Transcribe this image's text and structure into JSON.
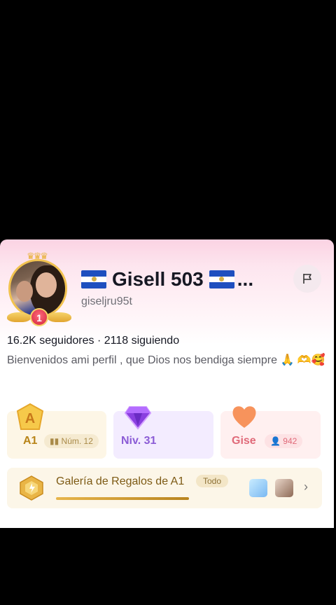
{
  "profile": {
    "display_name": "Gisell 503",
    "ellipsis": "...",
    "username": "giseljru95t",
    "stats": "16.2K seguidores · 2118 siguiendo",
    "bio": "Bienvenidos ami perfil , que Dios nos bendiga siempre 🙏 🫶🥰",
    "rank_badge": "1",
    "flag": "El Salvador"
  },
  "tiles": [
    {
      "label": "A1",
      "chip": "Núm. 12",
      "icon": "fan-club-badge-icon"
    },
    {
      "label": "Niv. 31",
      "icon": "diamond-level-icon"
    },
    {
      "label": "Gise",
      "chip": "942",
      "icon": "heart-icon"
    }
  ],
  "gallery": {
    "title": "Galería de Regalos de A1",
    "todo": "Todo",
    "progress": 0.52
  },
  "colors": {
    "gold": "#b88418",
    "purple": "#8b5cd6",
    "pink": "#e06a79",
    "flag_blue": "#1e4fbf"
  }
}
